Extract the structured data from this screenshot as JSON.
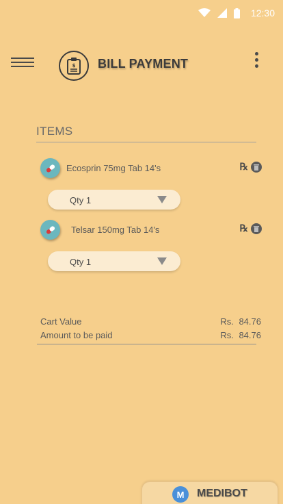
{
  "status_bar": {
    "time": "12:30",
    "icons": [
      "wifi-icon",
      "signal-icon",
      "battery-icon"
    ]
  },
  "app_bar": {
    "title": "BILL PAYMENT",
    "menu_icon": "hamburger-icon",
    "logo_icon": "bill-clipboard-icon",
    "more_icon": "more-vert-icon"
  },
  "items_section": {
    "title": "ITEMS",
    "items": [
      {
        "name": "Ecosprin 75mg  Tab 14's",
        "rx_label": "℞",
        "qty_label": "Qty 1"
      },
      {
        "name": "Telsar 150mg Tab 14's",
        "rx_label": "℞",
        "qty_label": "Qty 1"
      }
    ]
  },
  "totals": {
    "cart_value_label": "Cart Value",
    "cart_value": "Rs. 84.76",
    "amount_label": "Amount to be paid",
    "amount": "Rs. 84.76"
  },
  "brand": {
    "logo_letter": "M",
    "name": "MEDIBOT"
  },
  "colors": {
    "background": "#f6cf8c",
    "pill_bg": "#6bb7be",
    "select_bg": "#fbecd2",
    "brand_blue": "#4a90d9"
  }
}
